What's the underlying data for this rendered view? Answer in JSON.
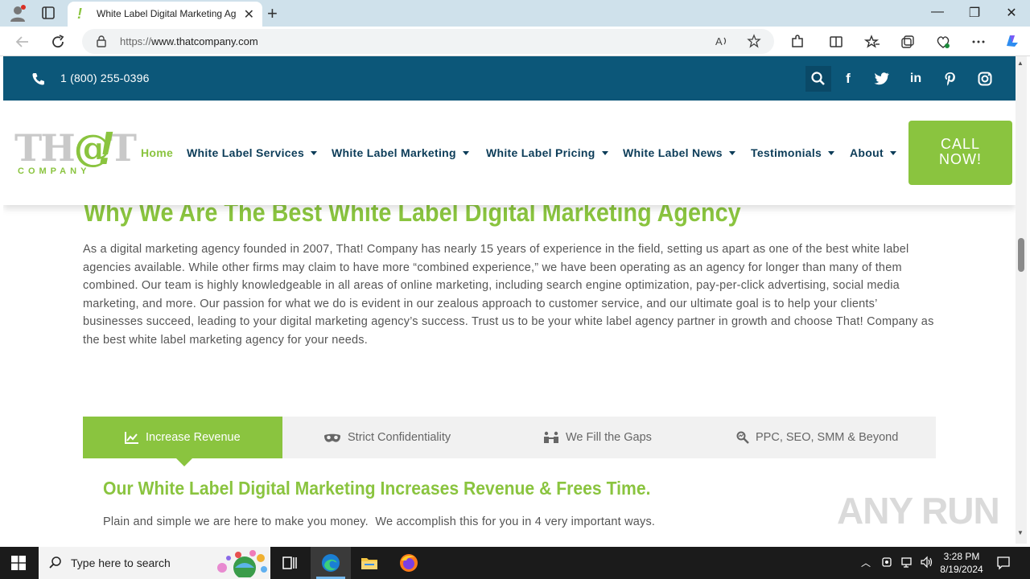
{
  "browser": {
    "tab_title": "White Label Digital Marketing Ag",
    "url_prefix": "https://",
    "url_host": "www.thatcompany.com"
  },
  "topbar": {
    "phone": "1 (800) 255-0396"
  },
  "logo": {
    "that_pre": "TH",
    "that_at": "@",
    "that_post": "T",
    "bang": "!",
    "company": "COMPANY"
  },
  "nav": {
    "items": [
      {
        "label": "Home"
      },
      {
        "label": "White Label Services"
      },
      {
        "label": "White Label Marketing"
      },
      {
        "label": "White Label Pricing"
      },
      {
        "label": "White Label News"
      },
      {
        "label": "Testimonials"
      },
      {
        "label": "About"
      }
    ],
    "cta_line1": "CALL",
    "cta_line2": "NOW!"
  },
  "content": {
    "heading": "Why We Are The Best White Label Digital Marketing Agency",
    "paragraph": "As a digital marketing agency founded in 2007, That! Company has nearly 15 years of experience in the field, setting us apart as one of the best white label agencies available. While other firms may claim to have more “combined experience,” we have been operating as an agency for longer than many of them combined. Our team is highly knowledgeable in all areas of online marketing, including search engine optimization, pay-per-click advertising, social media marketing, and more. Our passion for what we do is evident in our zealous approach to customer service, and our ultimate goal is to help your clients’ businesses succeed, leading to your digital marketing agency’s success. Trust us to be your white label agency partner in growth and choose That! Company as the best white label marketing agency for your needs.",
    "tabs": [
      {
        "label": "Increase Revenue",
        "icon": "chart-line-icon",
        "active": true
      },
      {
        "label": "Strict Confidentiality",
        "icon": "mask-icon"
      },
      {
        "label": "We Fill the Gaps",
        "icon": "people-icon"
      },
      {
        "label": "PPC, SEO, SMM & Beyond",
        "icon": "search-chart-icon"
      }
    ],
    "subheading": "Our White Label Digital Marketing Increases Revenue & Frees Time.",
    "subparagraph": "Plain and simple we are here to make you money.  We accomplish this for you in 4 very important ways."
  },
  "watermark": "ANY RUN",
  "taskbar": {
    "search_placeholder": "Type here to search",
    "time": "3:28 PM",
    "date": "8/19/2024"
  },
  "colors": {
    "brand_green": "#8ac43f",
    "brand_blue": "#0c5779",
    "nav_text": "#0c3c58"
  }
}
